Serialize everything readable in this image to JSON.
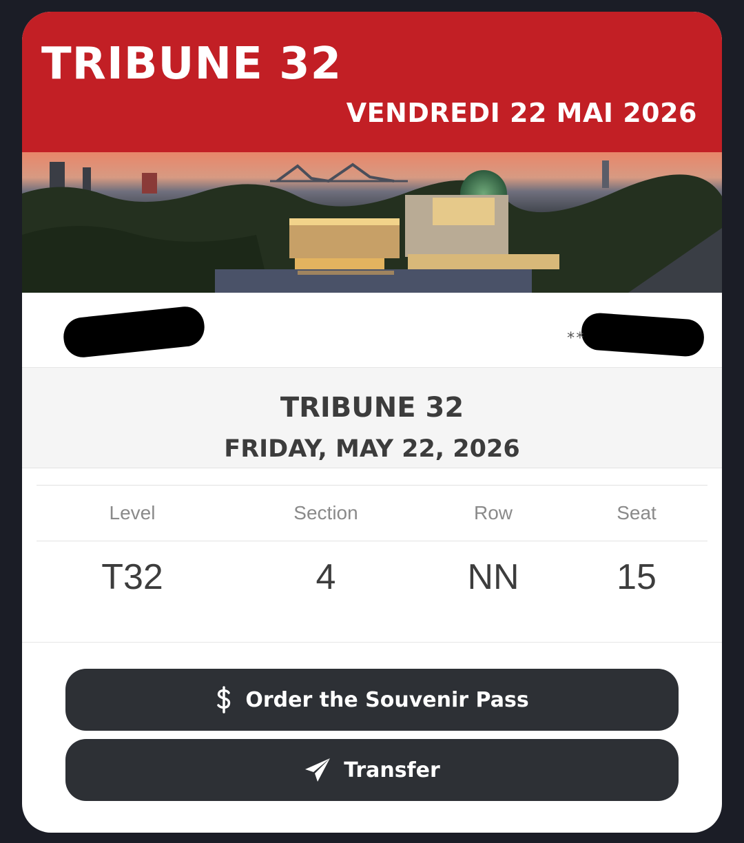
{
  "header": {
    "title": "TRIBUNE 32",
    "date": "VENDREDI 22 MAI 2026",
    "background_color": "#c21f25"
  },
  "holder": {
    "masked_text": "**"
  },
  "event": {
    "title": "TRIBUNE 32",
    "date": "FRIDAY, MAY 22, 2026"
  },
  "seat": {
    "columns": [
      {
        "label": "Level",
        "value": "T32"
      },
      {
        "label": "Section",
        "value": "4"
      },
      {
        "label": "Row",
        "value": "NN"
      },
      {
        "label": "Seat",
        "value": "15"
      }
    ]
  },
  "buttons": {
    "souvenir": {
      "label": "Order the Souvenir Pass",
      "icon": "dollar-icon"
    },
    "transfer": {
      "label": "Transfer",
      "icon": "paper-plane-icon"
    }
  },
  "colors": {
    "page_background": "#1b1d26",
    "button_background": "#2d3035"
  }
}
